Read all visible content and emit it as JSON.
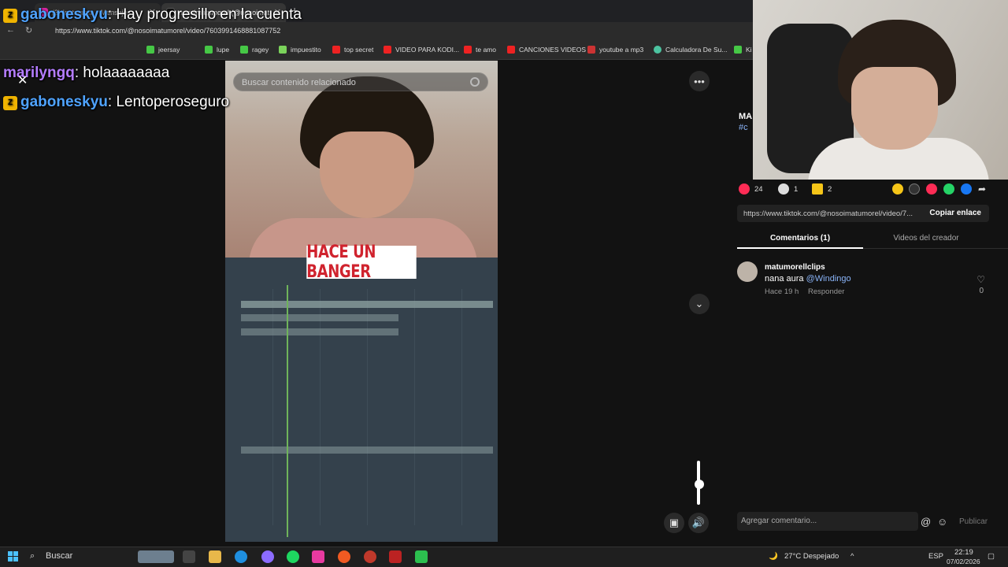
{
  "browser": {
    "tabs": [
      {
        "label": "(3) Instagram • Mensajes"
      },
      {
        "label": "nosoimatumorel (@nosoimat"
      }
    ],
    "url": "https://www.tiktok.com/@nosoimatumorel/video/7603991468881087752",
    "bookmarks": [
      "jeersay",
      "lupe",
      "ragey",
      "impuestito",
      "top secret",
      "VIDEO PARA KODI...",
      "te amo",
      "CANCIONES VIDEOS",
      "youtube a mp3",
      "Calculadora De Su...",
      "Ki"
    ]
  },
  "chat": [
    {
      "user": "gaboneskyu",
      "message": "Hay progresillo en la cuenta",
      "user_color": "#4fa3ff"
    },
    {
      "user": "marilyngq",
      "message": "holaaaaaaaa",
      "user_color": "#b47cff"
    },
    {
      "user": "gaboneskyu",
      "message": "Lentoperoseguro",
      "user_color": "#4fa3ff"
    }
  ],
  "video": {
    "search_placeholder": "Buscar contenido relacionado",
    "caption": "HACE UN BANGER",
    "more_icon": "more-icon",
    "next_icon": "chevron-down-icon"
  },
  "post": {
    "author_short": "MA",
    "hashtag_short": "#c",
    "likes": "24",
    "comments": "1",
    "saves": "2",
    "link": "https://www.tiktok.com/@nosoimatumorel/video/7...",
    "copy_label": "Copiar enlace"
  },
  "tabs": {
    "comments": "Comentarios (1)",
    "creator_videos": "Videos del creador"
  },
  "comment": {
    "user": "matumorellclips",
    "text": "nana aura ",
    "mention": "@Windingo",
    "time": "Hace 19 h",
    "reply": "Responder",
    "likes": "0"
  },
  "composer": {
    "placeholder": "Agregar comentario...",
    "publish": "Publicar"
  },
  "taskbar": {
    "search": "Buscar",
    "weather": "27°C Despejado",
    "lang": "ESP",
    "time": "22:19",
    "date": "07/02/2026"
  },
  "colors": {
    "accent_red": "#fe2c55",
    "mention_blue": "#8ab4f8"
  }
}
